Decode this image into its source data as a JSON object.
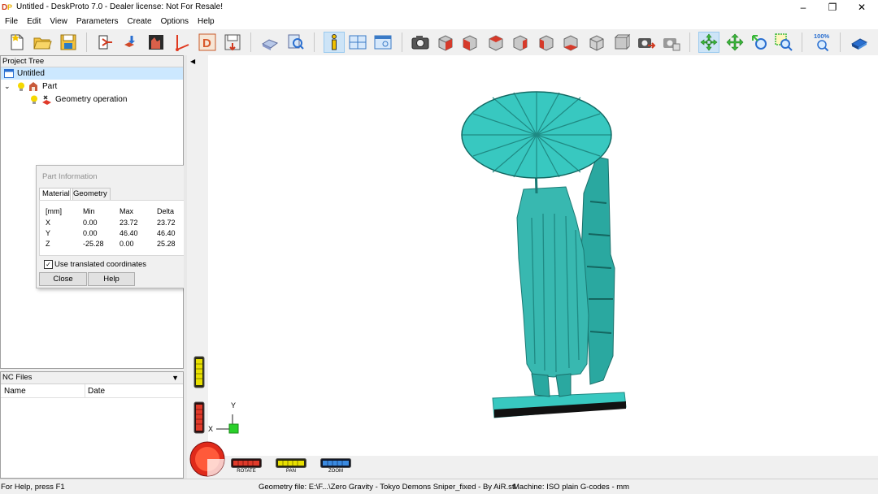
{
  "window": {
    "title": "Untitled - DeskProto 7.0 - Dealer license: Not For Resale!",
    "controls": {
      "minimize": "–",
      "maximize": "❐",
      "close": "✕"
    }
  },
  "menu": [
    "File",
    "Edit",
    "View",
    "Parameters",
    "Create",
    "Options",
    "Help"
  ],
  "toolbar": {
    "zoom_label": "100%",
    "icons": [
      "new-project-icon",
      "open-project-icon",
      "save-project-icon",
      "machine-icon",
      "part-import-icon",
      "geometry-icon",
      "toolpath-icon",
      "drawing-icon",
      "save-nc-icon",
      "simulate-icon",
      "preview-icon",
      "info-icon",
      "layout-icon",
      "view-window-icon",
      "camera-icon",
      "view-front-icon",
      "view-back-icon",
      "view-left-icon",
      "view-right-icon",
      "view-top-icon",
      "view-bottom-icon",
      "view-iso-icon",
      "view-iso2-icon",
      "screenshot-icon",
      "screenshot2-icon",
      "rotate-icon",
      "pan-icon",
      "zoom-icon",
      "zoom-window-icon",
      "zoom-100-icon",
      "help-book-icon"
    ],
    "active": [
      "info-icon",
      "rotate-icon"
    ]
  },
  "project_tree": {
    "header": "Project Tree",
    "items": [
      {
        "label": "Untitled",
        "level": 0,
        "selected": true
      },
      {
        "label": "Part",
        "level": 1,
        "selected": false
      },
      {
        "label": "Geometry operation",
        "level": 2,
        "selected": false
      }
    ]
  },
  "part_info": {
    "title": "Part Information",
    "tabs": [
      "Material",
      "Geometry"
    ],
    "active_tab": "Material",
    "headers": [
      "[mm]",
      "Min",
      "Max",
      "Delta"
    ],
    "rows": [
      [
        "X",
        "0.00",
        "23.72",
        "23.72"
      ],
      [
        "Y",
        "0.00",
        "46.40",
        "46.40"
      ],
      [
        "Z",
        "-25.28",
        "0.00",
        "25.28"
      ]
    ],
    "checkbox_label": "Use translated coordinates",
    "checkbox_checked": true,
    "close_label": "Close",
    "help_label": "Help"
  },
  "nc_files": {
    "header": "NC Files",
    "columns": [
      "Name",
      "Date"
    ]
  },
  "view_controls": {
    "rotate_label": "ROTATE",
    "pan_label": "PAN",
    "zoom_label": "ZOOM",
    "axis_x": "X",
    "axis_y": "Y"
  },
  "status": {
    "help": "For Help, press F1",
    "geometry": "Geometry file: E:\\F...\\Zero Gravity - Tokyo Demons Sniper_fixed - By AiR.stl",
    "machine": "Machine: ISO plain G-codes - mm"
  },
  "colors": {
    "model": "#38b8b0",
    "model_dark": "#1f8a84",
    "selection": "#cce8ff",
    "toolbar_bg": "#f0f0f0"
  }
}
